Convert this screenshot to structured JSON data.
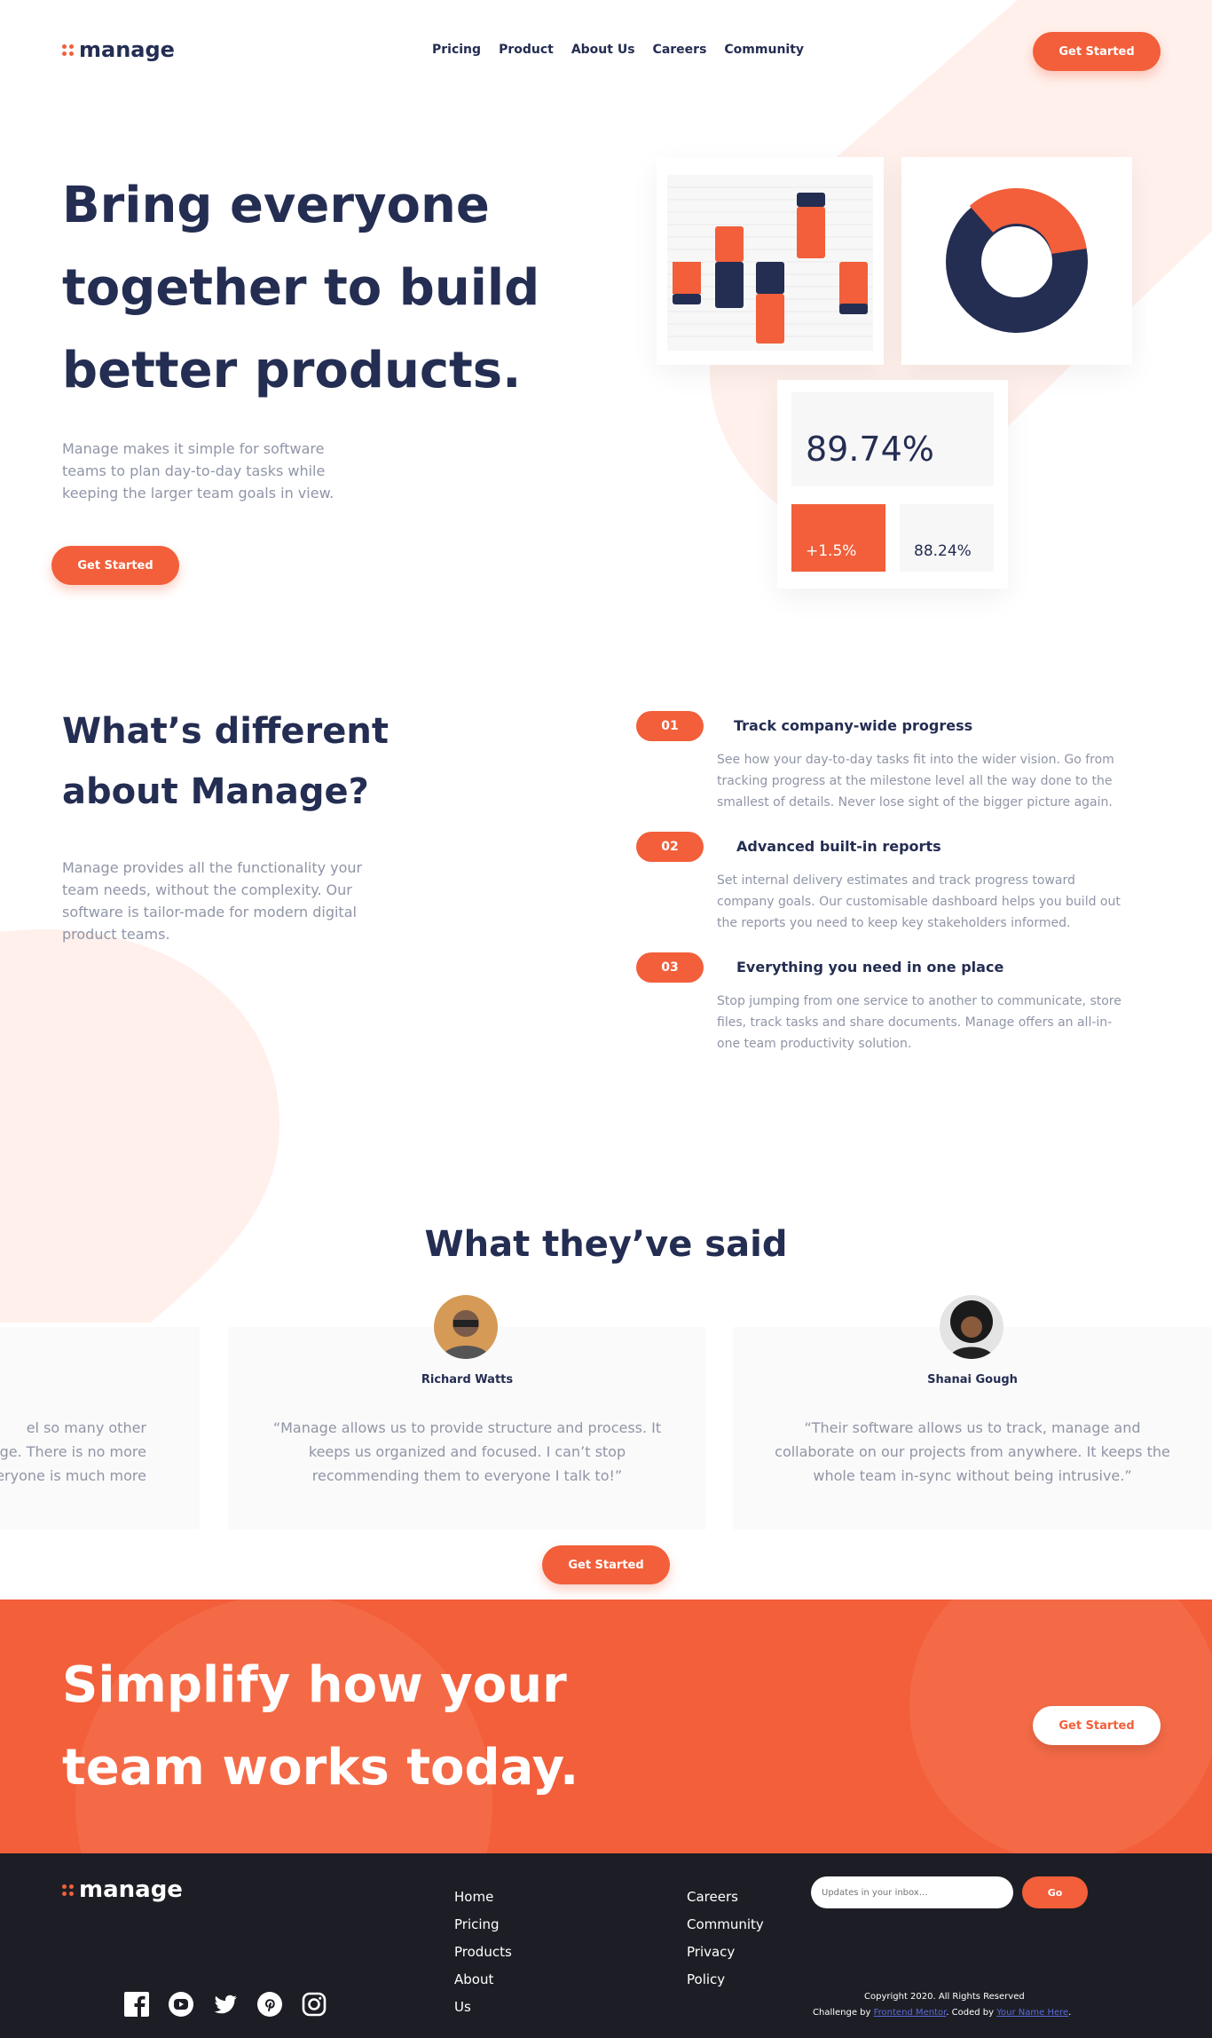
{
  "header": {
    "brand": "manage",
    "nav": [
      "Pricing",
      "Product",
      "About Us",
      "Careers",
      "Community"
    ],
    "cta": "Get Started"
  },
  "hero": {
    "title": "Bring everyone together to build better products.",
    "text": "Manage makes it simple for software teams to plan day-to-day tasks while keeping the larger team goals in view.",
    "cta": "Get Started",
    "stats": {
      "main": "89.74%",
      "change": "+1.5%",
      "secondary": "88.24%"
    }
  },
  "different": {
    "title": "What’s different about Manage?",
    "text": "Manage provides all the functionality your team needs, without the complexity. Our software is tailor-made for modern digital product teams.",
    "features": [
      {
        "num": "01",
        "title": "Track company-wide progress",
        "text": "See how your day-to-day tasks fit into the wider vision. Go from tracking progress at the milestone level all the way done to the smallest of details. Never lose sight of the bigger picture again."
      },
      {
        "num": "02",
        "title": "Advanced built-in reports",
        "text": "Set internal delivery estimates and track progress toward company goals. Our customisable dashboard helps you build out the reports you need to keep key stakeholders informed."
      },
      {
        "num": "03",
        "title": "Everything you need in one place",
        "text": "Stop jumping from one service to another to communicate, store files, track tasks and share documents. Manage offers an all-in-one team productivity solution."
      }
    ]
  },
  "testimonials": {
    "title": "What they’ve said",
    "items": [
      {
        "name": "",
        "quote": "el so many other\nge. There is no more\neryone is much more"
      },
      {
        "name": "Richard Watts",
        "quote": "“Manage allows us to provide structure and process. It keeps us organized and focused. I can’t stop recommending them to everyone I talk to!”"
      },
      {
        "name": "Shanai Gough",
        "quote": "“Their software allows us to track, manage and collaborate on our projects from anywhere. It keeps the whole team in-sync without being intrusive.”"
      }
    ],
    "cta": "Get Started"
  },
  "cta_band": {
    "title": "Simplify how your team works today.",
    "button": "Get Started"
  },
  "footer": {
    "brand": "manage",
    "links_col1": [
      "Home",
      "Pricing",
      "Products",
      "About",
      "Us"
    ],
    "links_col2": [
      "Careers",
      "Community",
      "Privacy",
      "Policy"
    ],
    "newsletter_placeholder": "Updates in your inbox…",
    "go": "Go",
    "copyright": "Copyright 2020. All Rights Reserved",
    "challenge_prefix": "Challenge by ",
    "challenge_link": "Frontend Mentor",
    "coded_prefix": ". Coded by ",
    "coded_link": "Your Name Here",
    "coded_suffix": ".",
    "social": [
      "facebook-icon",
      "youtube-icon",
      "twitter-icon",
      "pinterest-icon",
      "instagram-icon"
    ]
  },
  "colors": {
    "accent": "#f25f3a",
    "navy": "#242d52",
    "footer_bg": "#1d1e25",
    "tint": "#fff0ec"
  }
}
